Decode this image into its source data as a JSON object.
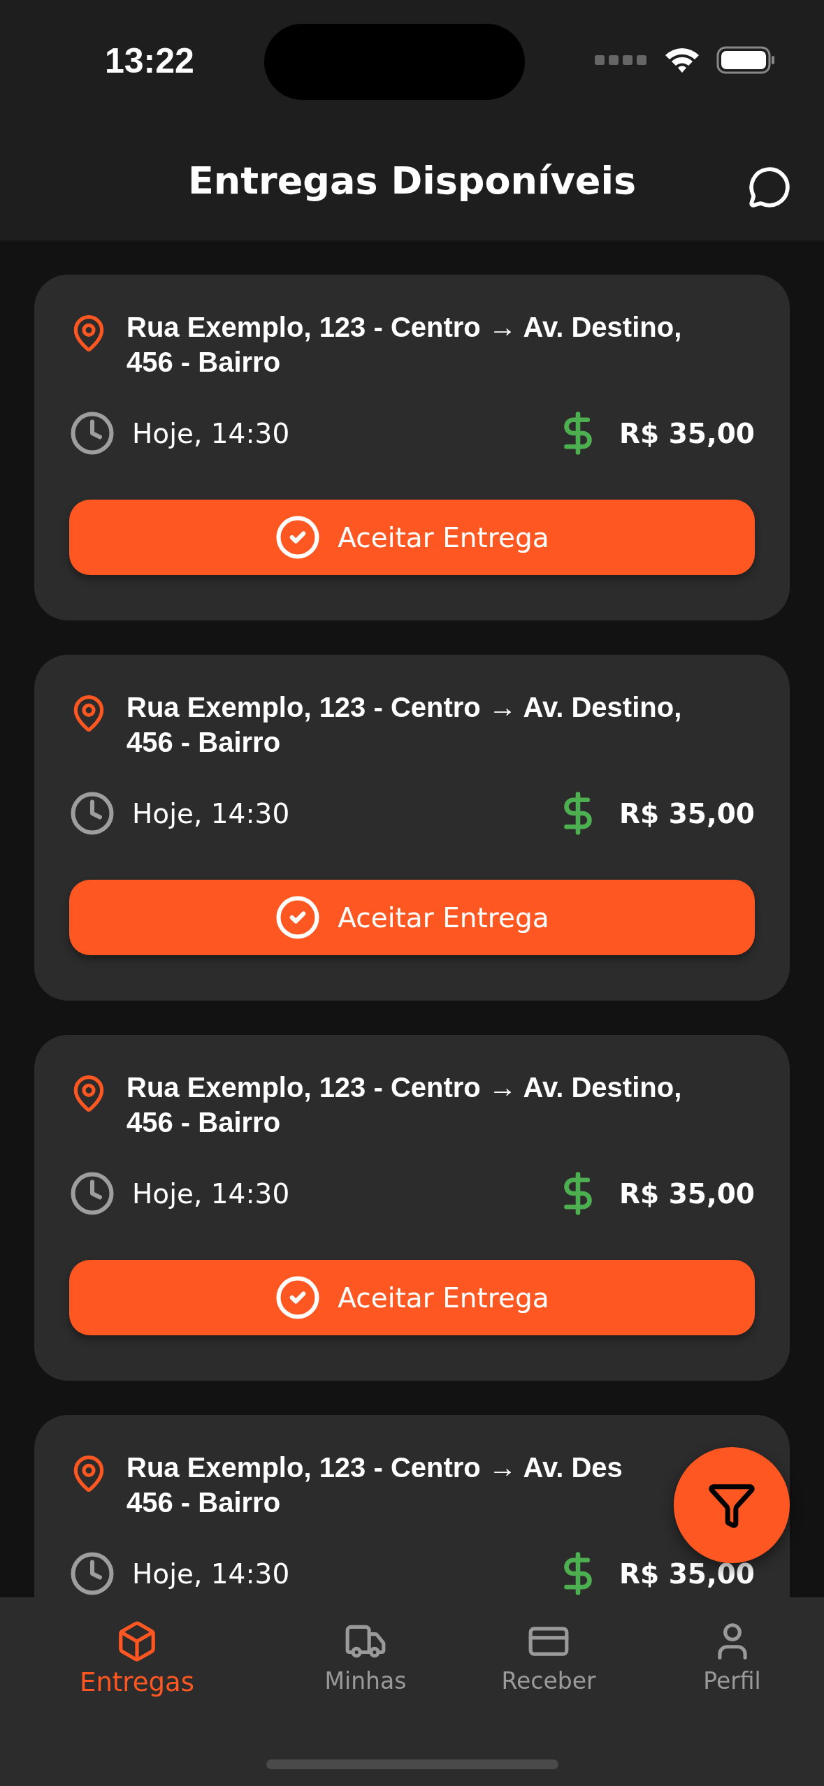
{
  "status_bar": {
    "time": "13:22"
  },
  "header": {
    "title": "Entregas Disponíveis"
  },
  "deliveries": [
    {
      "address_lines": [
        "Rua Exemplo, 123 - Centro → Av. Destino,",
        "456 - Bairro"
      ],
      "time": "Hoje, 14:30",
      "price": "R$ 35,00",
      "action": "Aceitar Entrega"
    },
    {
      "address_lines": [
        "Rua Exemplo, 123 - Centro → Av. Destino,",
        "456 - Bairro"
      ],
      "time": "Hoje, 14:30",
      "price": "R$ 35,00",
      "action": "Aceitar Entrega"
    },
    {
      "address_lines": [
        "Rua Exemplo, 123 - Centro → Av. Destino,",
        "456 - Bairro"
      ],
      "time": "Hoje, 14:30",
      "price": "R$ 35,00",
      "action": "Aceitar Entrega"
    },
    {
      "address_lines": [
        "Rua Exemplo, 123 - Centro → Av. Des",
        "456 - Bairro"
      ],
      "time": "Hoje, 14:30",
      "price": "R$ 35,00"
    }
  ],
  "nav": {
    "items": [
      {
        "kind": "box",
        "label": "Entregas",
        "selected": true
      },
      {
        "kind": "truck",
        "label": "Minhas",
        "selected": false
      },
      {
        "kind": "card",
        "label": "Receber",
        "selected": false
      },
      {
        "kind": "user",
        "label": "Perfil",
        "selected": false
      }
    ]
  }
}
